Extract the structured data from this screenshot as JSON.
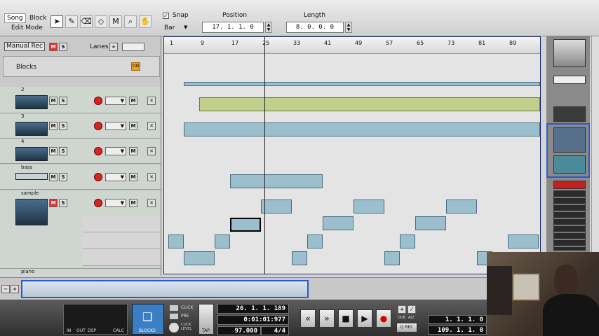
{
  "toolbar": {
    "song": "Song",
    "block": "Block",
    "edit_mode": "Edit Mode",
    "snap_label": "Snap",
    "snap_checked": true,
    "snap_value": "Bar",
    "position_label": "Position",
    "position_value": "17.  1.  1.    0",
    "length_label": "Length",
    "length_value": "8.  0.  0.    0"
  },
  "tracklist": {
    "manual_rec": "Manual Rec",
    "lanes": "Lanes",
    "blocks": "Blocks",
    "blocks_toggle": "ON",
    "tracks": [
      {
        "name": "2"
      },
      {
        "name": "3"
      },
      {
        "name": "4"
      },
      {
        "name": "bass"
      },
      {
        "name": "sample"
      },
      {
        "name": "piano"
      }
    ],
    "m": "M",
    "s": "S"
  },
  "ruler": {
    "bars": [
      "1",
      "9",
      "17",
      "25",
      "33",
      "41",
      "49",
      "57",
      "65",
      "73",
      "81",
      "89"
    ]
  },
  "transport": {
    "click": "CLICK",
    "pre": "PRE",
    "click_level": "CLICK LEVEL",
    "tap": "TAP",
    "blocks": "BLOCKS",
    "in": "IN",
    "out": "OUT",
    "dsp": "DSP",
    "calc": "CALC",
    "song_pos": "26.  1.  1. 189",
    "time": "0:01:01:977",
    "tempo": "97.000",
    "signature": "4/4",
    "dub": "DUB",
    "alt": "ALT",
    "qrec": "Q REC",
    "loop_left": "1.  1.  1.    0",
    "loop_right": "109.  1.  1.    0"
  }
}
